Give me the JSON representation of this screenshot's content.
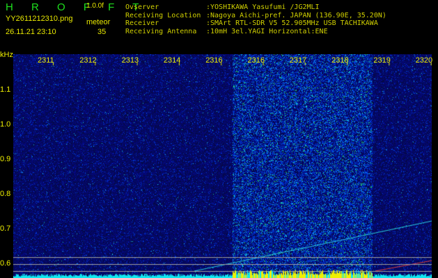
{
  "app": {
    "title": "H R O F F T",
    "version": "1.0.0f"
  },
  "file": {
    "name": "YY2611212310.png",
    "datetime": "26.11.21 23:10"
  },
  "meteor": {
    "label": "meteor",
    "count": "35"
  },
  "info": [
    {
      "label": "Ovserver",
      "value": ":YOSHIKAWA Yasufumi /JG2MLI"
    },
    {
      "label": "Receiving Location",
      "value": ":Nagoya Aichi-pref. JAPAN (136.90E, 35.20N)"
    },
    {
      "label": "Receiver",
      "value": ":SMArt RTL-SDR V5 52.905MHz USB TACHIKAWA"
    },
    {
      "label": "Receiving Antenna",
      "value": ":10mH 3el.YAGI Horizontal:ENE"
    }
  ],
  "axis": {
    "unit": "kHz",
    "y_ticks": [
      "1.1",
      "1.0",
      "0.9",
      "0.8",
      "0.7",
      "0.6"
    ],
    "time_ticks": [
      "2311",
      "2312",
      "2313",
      "2314",
      "2316",
      "2316",
      "2317",
      "2318",
      "2319",
      "2320"
    ]
  },
  "colors": {
    "bg": "#000000",
    "noise": "#0a1a9a",
    "signal": "#1ef0f0",
    "label": "#f0f000"
  }
}
